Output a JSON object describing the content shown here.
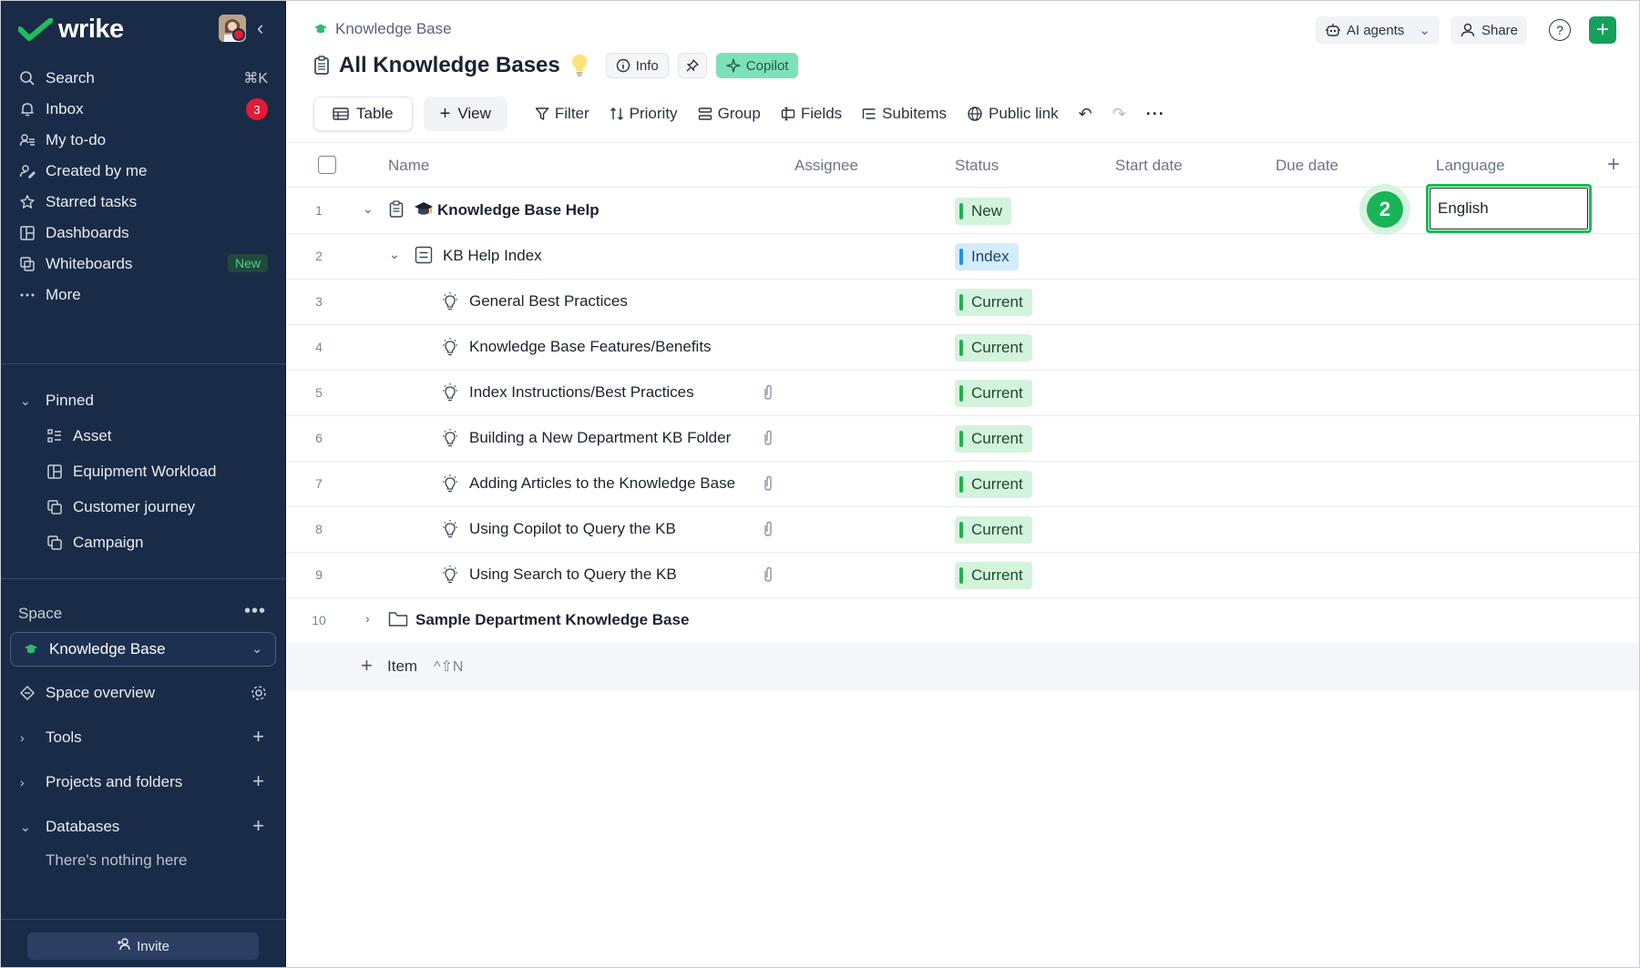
{
  "app": {
    "name": "wrike"
  },
  "sidebar": {
    "nav": [
      {
        "label": "Search",
        "icon": "search-icon",
        "shortcut": "⌘K"
      },
      {
        "label": "Inbox",
        "icon": "bell-icon",
        "badge": "3"
      },
      {
        "label": "My to-do",
        "icon": "user-list-icon"
      },
      {
        "label": "Created by me",
        "icon": "user-edit-icon"
      },
      {
        "label": "Starred tasks",
        "icon": "star-icon"
      },
      {
        "label": "Dashboards",
        "icon": "dashboard-icon"
      },
      {
        "label": "Whiteboards",
        "icon": "whiteboard-icon",
        "tag": "New"
      },
      {
        "label": "More",
        "icon": "more-icon"
      }
    ],
    "pinned": {
      "label": "Pinned",
      "items": [
        {
          "label": "Asset",
          "icon": "asset-icon"
        },
        {
          "label": "Equipment Workload",
          "icon": "workload-icon"
        },
        {
          "label": "Customer journey",
          "icon": "copy-icon"
        },
        {
          "label": "Campaign",
          "icon": "copy-icon"
        }
      ]
    },
    "space": {
      "label": "Space",
      "selected": "Knowledge Base",
      "overview": "Space overview",
      "sections": [
        "Tools",
        "Projects and folders",
        "Databases"
      ],
      "empty_note": "There's nothing here"
    },
    "invite_label": "Invite"
  },
  "header": {
    "breadcrumb": "Knowledge Base",
    "title": "All Knowledge Bases",
    "info_label": "Info",
    "copilot_label": "Copilot",
    "ai_agents_label": "AI agents",
    "share_label": "Share",
    "help_glyph": "?",
    "add_glyph": "+"
  },
  "toolbar": {
    "table_label": "Table",
    "view_label": "View",
    "filter_label": "Filter",
    "priority_label": "Priority",
    "group_label": "Group",
    "fields_label": "Fields",
    "subitems_label": "Subitems",
    "public_link_label": "Public link"
  },
  "table": {
    "columns": [
      "Name",
      "Assignee",
      "Status",
      "Start date",
      "Due date",
      "Language"
    ],
    "rows": [
      {
        "num": "1",
        "name": "Knowledge Base Help",
        "status": "New",
        "status_color": "#20b053",
        "language": "English",
        "bold": true
      },
      {
        "num": "2",
        "name": "KB Help Index",
        "status": "Index",
        "status_color": "#1e94df"
      },
      {
        "num": "3",
        "name": "General Best Practices",
        "status": "Current",
        "status_color": "#20b053"
      },
      {
        "num": "4",
        "name": "Knowledge Base Features/Benefits",
        "status": "Current",
        "status_color": "#20b053"
      },
      {
        "num": "5",
        "name": "Index Instructions/Best Practices",
        "status": "Current",
        "status_color": "#20b053",
        "attachment": true
      },
      {
        "num": "6",
        "name": "Building a New Department KB Folder",
        "status": "Current",
        "status_color": "#20b053",
        "attachment": true
      },
      {
        "num": "7",
        "name": "Adding Articles to the Knowledge Base",
        "status": "Current",
        "status_color": "#20b053",
        "attachment": true
      },
      {
        "num": "8",
        "name": "Using Copilot to Query the KB",
        "status": "Current",
        "status_color": "#20b053",
        "attachment": true
      },
      {
        "num": "9",
        "name": "Using Search to Query the KB",
        "status": "Current",
        "status_color": "#20b053",
        "attachment": true
      },
      {
        "num": "10",
        "name": "Sample Department Knowledge Base",
        "status": "",
        "bold": true
      }
    ],
    "add_item_label": "Item",
    "add_item_shortcut": "^⇧N"
  },
  "overlay": {
    "step_number": "2"
  }
}
